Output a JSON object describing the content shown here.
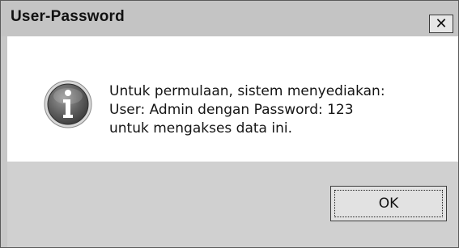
{
  "window": {
    "title": "User-Password",
    "close_glyph": "✕"
  },
  "message": {
    "icon": "info-icon",
    "lines": [
      "Untuk permulaan, sistem menyediakan:",
      "User: Admin dengan Password: 123",
      "untuk mengakses data ini."
    ]
  },
  "buttons": {
    "ok_label": "OK"
  }
}
